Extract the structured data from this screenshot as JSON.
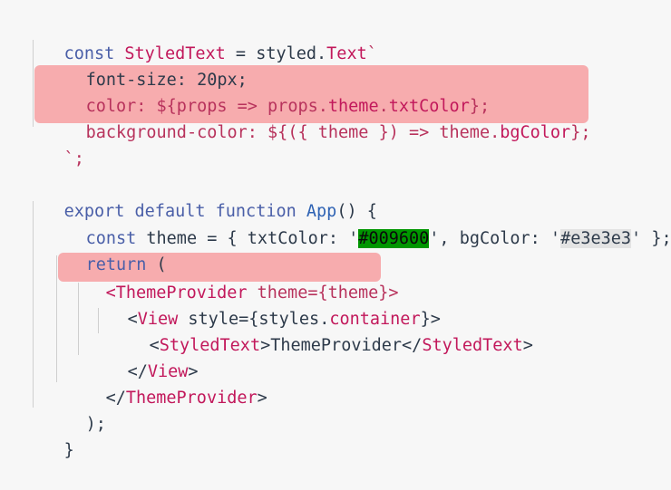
{
  "code_lines": [
    [
      "const ",
      "StyledText",
      " = styled.",
      "Text",
      "`"
    ],
    [
      "font-size: ",
      "20px",
      ";"
    ],
    [
      "color: ",
      "${props => props.",
      "theme",
      ".",
      "txtColor",
      "};"
    ],
    [
      "background-color: ",
      "${({ theme }) => theme.",
      "bgColor",
      "};"
    ],
    [
      "`;"
    ],
    [
      "export ",
      "default ",
      "function ",
      "App",
      "() {"
    ],
    [
      "const ",
      "theme",
      " = { txtColor: '",
      "#009600",
      "', bgColor: '",
      "#e3e3e3",
      "' };"
    ],
    [
      "return",
      " ("
    ],
    [
      "<",
      "ThemeProvider",
      " theme={theme}>"
    ],
    [
      "<",
      "View",
      " style={styles.",
      "container",
      "}>"
    ],
    [
      "<",
      "StyledText",
      ">ThemeProvider</",
      "StyledText",
      ">"
    ],
    [
      "</",
      "View",
      ">"
    ],
    [
      "</",
      "ThemeProvider",
      ">"
    ],
    [
      ");"
    ],
    [
      "}"
    ]
  ],
  "highlight_colors": {
    "line_highlight": "#f7a8aa",
    "green_swatch": "#009600",
    "gray_swatch": "#e3e3e3"
  }
}
